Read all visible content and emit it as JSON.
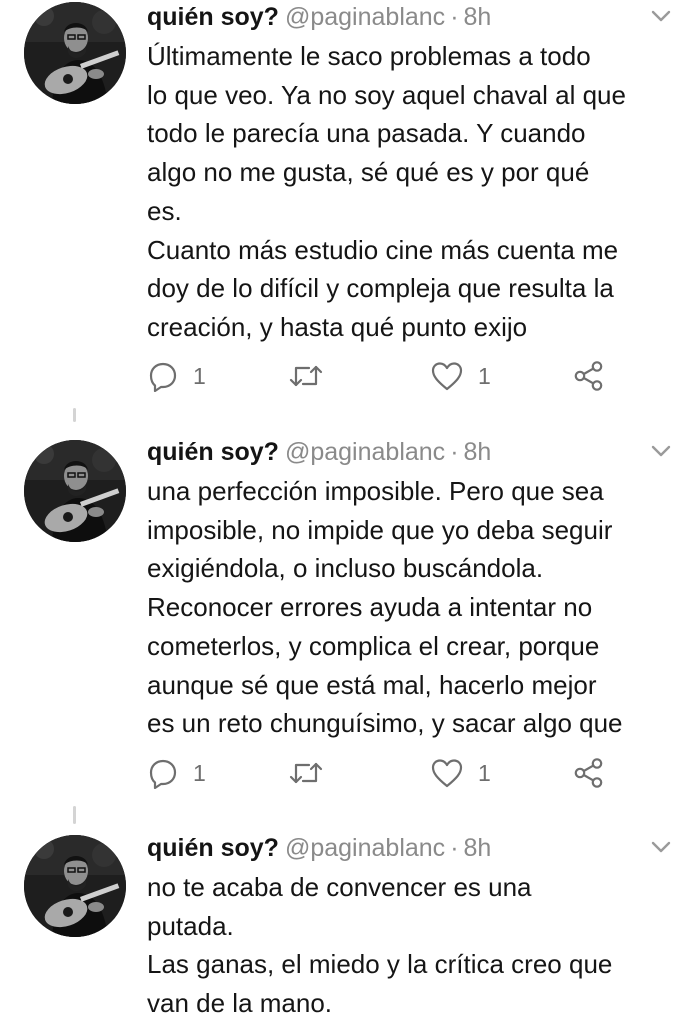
{
  "tweets": [
    {
      "name": "quién soy?",
      "handle": "@paginablanc",
      "separator": "·",
      "time": "8h",
      "lines": [
        "Últimamente le saco problemas a todo",
        "lo que veo. Ya no soy aquel chaval al que",
        "todo le parecía una pasada. Y cuando",
        "algo no me gusta, sé qué es y por qué",
        "es.",
        "Cuanto más estudio cine más cuenta me",
        "doy de lo difícil y compleja que resulta la",
        "creación, y hasta qué punto exijo"
      ],
      "replies": "1",
      "retweets": "",
      "likes": "1"
    },
    {
      "name": "quién soy?",
      "handle": "@paginablanc",
      "separator": "·",
      "time": "8h",
      "lines": [
        "una perfección imposible. Pero que sea",
        "imposible, no impide que yo deba seguir",
        "exigiéndola, o incluso buscándola.",
        "Reconocer errores ayuda a intentar no",
        "cometerlos, y complica el crear, porque",
        "aunque sé que está mal, hacerlo mejor",
        "es un reto chunguísimo, y sacar algo que"
      ],
      "replies": "1",
      "retweets": "",
      "likes": "1"
    },
    {
      "name": "quién soy?",
      "handle": "@paginablanc",
      "separator": "·",
      "time": "8h",
      "lines": [
        "no te acaba de convencer es una",
        "putada.",
        "Las ganas, el miedo y la crítica creo que",
        "van de la mano."
      ]
    }
  ],
  "icons": {
    "reply": "reply-icon",
    "retweet": "retweet-icon",
    "like": "heart-icon",
    "share": "share-icon",
    "menu": "chevron-down-icon"
  },
  "colors": {
    "text": "#151515",
    "secondary": "#8a8a8a",
    "icon": "#6e6e6e",
    "thread_line": "#d4d4d4"
  }
}
